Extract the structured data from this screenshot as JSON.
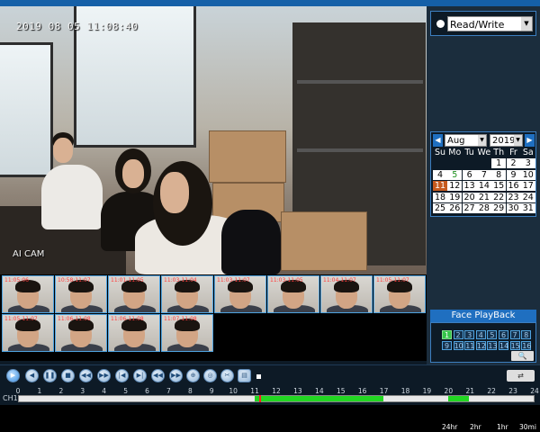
{
  "camera": {
    "osd_timestamp": "2019 08 05 11:08:40",
    "osd_camera_name": "AI CAM"
  },
  "thumbnails": [
    {
      "label": "11:05:06"
    },
    {
      "label": "10:58:11:07"
    },
    {
      "label": "11:01-11:05"
    },
    {
      "label": "11:03-11:04"
    },
    {
      "label": "11:03-11:07"
    },
    {
      "label": "11:03-11:05"
    },
    {
      "label": "11:04-11:07"
    },
    {
      "label": "11:05-11:07"
    },
    {
      "label": "11:05-11:07"
    },
    {
      "label": "11:06-11:08"
    },
    {
      "label": "11:06-11:08"
    },
    {
      "label": "11:07-11:08"
    }
  ],
  "mode": {
    "selected": "Read/Write"
  },
  "calendar": {
    "month": "Aug",
    "year": "2019",
    "weekdays": [
      "Su",
      "Mo",
      "Tu",
      "We",
      "Th",
      "Fr",
      "Sa"
    ],
    "days": [
      [
        "",
        "",
        "",
        "",
        "1",
        "2",
        "3"
      ],
      [
        "4",
        "5",
        "6",
        "7",
        "8",
        "9",
        "10"
      ],
      [
        "11",
        "12",
        "13",
        "14",
        "15",
        "16",
        "17"
      ],
      [
        "18",
        "19",
        "20",
        "21",
        "22",
        "23",
        "24"
      ],
      [
        "25",
        "26",
        "27",
        "28",
        "29",
        "30",
        "31"
      ]
    ],
    "recorded_day": "5",
    "selected_day": "11"
  },
  "face_playback": {
    "title": "Face PlayBack",
    "channels": [
      "1",
      "2",
      "3",
      "4",
      "5",
      "6",
      "7",
      "8",
      "9",
      "10",
      "11",
      "12",
      "13",
      "14",
      "15",
      "16"
    ],
    "active_channel": "1"
  },
  "timeline": {
    "channel_label": "CH1",
    "hours": [
      "0",
      "1",
      "2",
      "3",
      "4",
      "5",
      "6",
      "7",
      "8",
      "9",
      "10",
      "11",
      "12",
      "13",
      "14",
      "15",
      "16",
      "17",
      "18",
      "19",
      "20",
      "21",
      "22",
      "23",
      "24"
    ],
    "recordings": [
      [
        11.0,
        17.0
      ],
      [
        20.0,
        21.0
      ]
    ],
    "cursor_hour": 11.2
  },
  "zoom_levels": [
    "24hr",
    "2hr",
    "1hr",
    "30mi"
  ],
  "colors": {
    "accent": "#1f6fc0",
    "recording": "#22d622",
    "cursor": "#ff2020"
  }
}
